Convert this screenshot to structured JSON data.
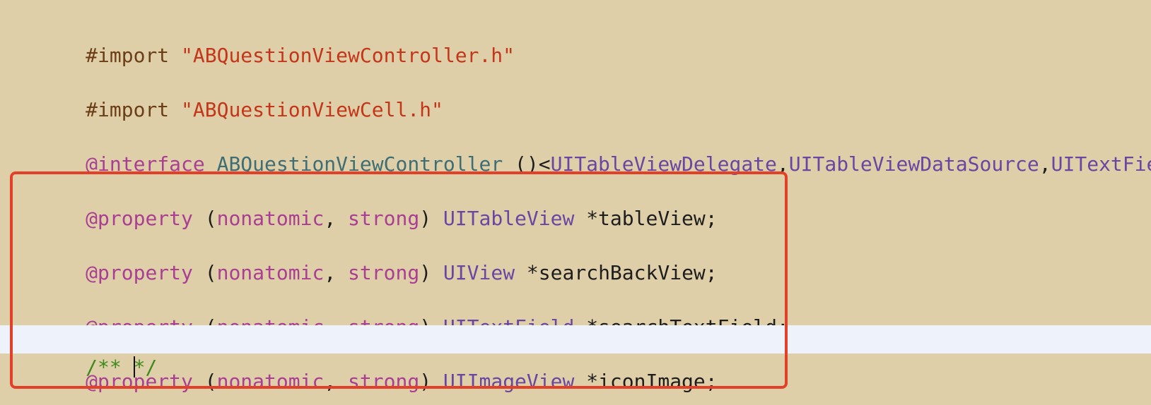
{
  "editor": {
    "colors": {
      "background": "#dfcfa8",
      "current_line": "#eef3fb",
      "preprocessor": "#6b3e18",
      "string": "#c3361a",
      "keyword": "#a93e93",
      "class_name": "#3e6d74",
      "type": "#6a46a3",
      "identifier": "#1d1d1d",
      "comment": "#3d8a1c",
      "annotation_box": "#e3402a"
    },
    "lines": [
      {
        "id": "import-1",
        "tokens": [
          {
            "kind": "pre",
            "text": "#import "
          },
          {
            "kind": "str",
            "text": "\"ABQuestionViewController.h\""
          }
        ]
      },
      {
        "id": "import-2",
        "tokens": [
          {
            "kind": "pre",
            "text": "#import "
          },
          {
            "kind": "str",
            "text": "\"ABQuestionViewCell.h\""
          }
        ]
      },
      {
        "id": "interface",
        "tokens": [
          {
            "kind": "kw",
            "text": "@interface"
          },
          {
            "kind": "id",
            "text": " "
          },
          {
            "kind": "cls",
            "text": "ABQuestionViewController"
          },
          {
            "kind": "id",
            "text": " ()<"
          },
          {
            "kind": "type",
            "text": "UITableViewDelegate"
          },
          {
            "kind": "id",
            "text": ","
          },
          {
            "kind": "type",
            "text": "UITableViewDataSource"
          },
          {
            "kind": "id",
            "text": ","
          },
          {
            "kind": "type",
            "text": "UITextFieldDelegate"
          }
        ]
      },
      {
        "id": "property-tableview",
        "tokens": [
          {
            "kind": "kw",
            "text": "@property"
          },
          {
            "kind": "id",
            "text": " ("
          },
          {
            "kind": "kw",
            "text": "nonatomic"
          },
          {
            "kind": "id",
            "text": ", "
          },
          {
            "kind": "kw",
            "text": "strong"
          },
          {
            "kind": "id",
            "text": ") "
          },
          {
            "kind": "type",
            "text": "UITableView"
          },
          {
            "kind": "id",
            "text": " *tableView;"
          }
        ]
      },
      {
        "id": "property-searchbackview",
        "tokens": [
          {
            "kind": "kw",
            "text": "@property"
          },
          {
            "kind": "id",
            "text": " ("
          },
          {
            "kind": "kw",
            "text": "nonatomic"
          },
          {
            "kind": "id",
            "text": ", "
          },
          {
            "kind": "kw",
            "text": "strong"
          },
          {
            "kind": "id",
            "text": ") "
          },
          {
            "kind": "type",
            "text": "UIView"
          },
          {
            "kind": "id",
            "text": " *searchBackView;"
          }
        ]
      },
      {
        "id": "property-searchtextfield",
        "tokens": [
          {
            "kind": "kw",
            "text": "@property"
          },
          {
            "kind": "id",
            "text": " ("
          },
          {
            "kind": "kw",
            "text": "nonatomic"
          },
          {
            "kind": "id",
            "text": ", "
          },
          {
            "kind": "kw",
            "text": "strong"
          },
          {
            "kind": "id",
            "text": ") "
          },
          {
            "kind": "type",
            "text": "UITextField"
          },
          {
            "kind": "id",
            "text": " *searchTextField;"
          }
        ]
      },
      {
        "id": "doc-comment",
        "current": true,
        "tokens": [
          {
            "kind": "cmt",
            "text": "/** "
          },
          {
            "kind": "caret",
            "text": ""
          },
          {
            "kind": "cmt",
            "text": "*/"
          }
        ]
      },
      {
        "id": "property-iconimage",
        "tokens": [
          {
            "kind": "kw",
            "text": "@property"
          },
          {
            "kind": "id",
            "text": " ("
          },
          {
            "kind": "kw",
            "text": "nonatomic"
          },
          {
            "kind": "id",
            "text": ", "
          },
          {
            "kind": "kw",
            "text": "strong"
          },
          {
            "kind": "id",
            "text": ") "
          },
          {
            "kind": "type",
            "text": "UIImageView"
          },
          {
            "kind": "id",
            "text": " *iconImage;"
          }
        ]
      }
    ]
  }
}
